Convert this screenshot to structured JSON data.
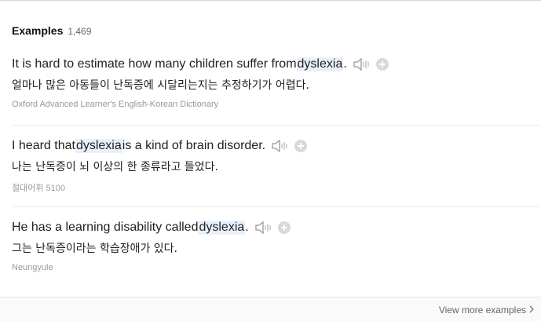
{
  "examples": {
    "heading": "Examples",
    "count": "1,469",
    "items": [
      {
        "en_before": "It is hard to estimate how many children suffer from ",
        "en_keyword": "dyslexia",
        "en_after": ".",
        "ko": "얼마나 많은 아동들이 난독증에 시달리는지는 추정하기가 어렵다.",
        "source": "Oxford Advanced Learner's English-Korean Dictionary"
      },
      {
        "en_before": "I heard that ",
        "en_keyword": "dyslexia",
        "en_after": " is a kind of brain disorder.",
        "ko": "나는 난독증이 뇌 이상의 한 종류라고 들었다.",
        "source": "절대어휘 5100"
      },
      {
        "en_before": "He has a learning disability called ",
        "en_keyword": "dyslexia",
        "en_after": ".",
        "ko": "그는 난독증이라는 학습장애가 있다.",
        "source": "Neungyule"
      }
    ]
  },
  "footer": {
    "view_more_label": "View more examples"
  },
  "icons": {
    "speaker": "speaker-icon",
    "add": "plus-circle-icon",
    "chevron": "chevron-right-icon"
  },
  "colors": {
    "highlight": "#e8f1fb",
    "icon_gray": "#9a9a9a"
  }
}
